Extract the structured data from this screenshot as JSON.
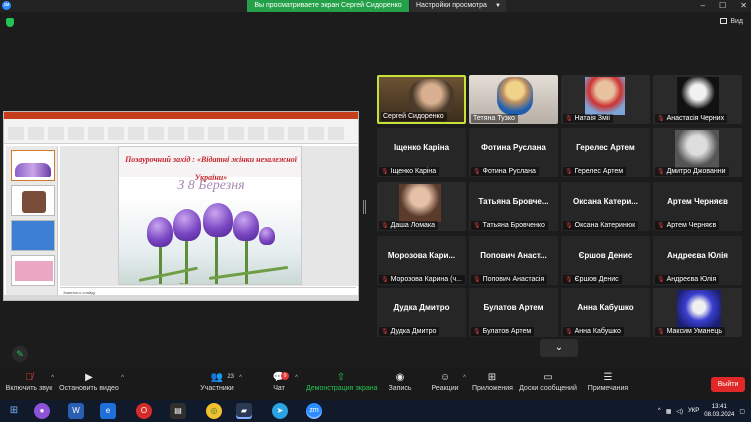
{
  "app": {
    "app_icon_text": "зм",
    "sharing_banner": "Вы просматриваете экран Сергей Сидоренко",
    "view_settings": "Настройки просмотра",
    "view_button": "Вид"
  },
  "slide": {
    "title": "Позаурочний захід : «Відатні жінки незалежної України»",
    "date_text": "З 8 Березня",
    "notes_placeholder": "Заметки к слайду"
  },
  "participants": [
    {
      "name": "Сергей Сидоренко",
      "big": "",
      "muted": false,
      "video": true
    },
    {
      "name": "Тетяна Тузко",
      "big": "",
      "muted": false,
      "video": true
    },
    {
      "name": "Натаія Зміі",
      "big": "",
      "muted": true,
      "video": true
    },
    {
      "name": "Анастасія Черних",
      "big": "",
      "muted": true,
      "video": true
    },
    {
      "name": "Іщенко Каріна",
      "big": "Іщенко Каріна",
      "muted": true,
      "video": false
    },
    {
      "name": "Фотина Руслана",
      "big": "Фотина Руслана",
      "muted": true,
      "video": false
    },
    {
      "name": "Герелес Артем",
      "big": "Герелес Артем",
      "muted": true,
      "video": false
    },
    {
      "name": "Дмитро Джованни",
      "big": "",
      "muted": true,
      "video": true
    },
    {
      "name": "Даша Ломака",
      "big": "",
      "muted": true,
      "video": true
    },
    {
      "name": "Татьяна Бровченко",
      "big": "Татьяна Бровче...",
      "muted": true,
      "video": false
    },
    {
      "name": "Оксана Катеринюк",
      "big": "Оксана Катери...",
      "muted": true,
      "video": false
    },
    {
      "name": "Артем Черняєв",
      "big": "Артем Черняєв",
      "muted": true,
      "video": false
    },
    {
      "name": "Морозова Карина (ч...",
      "big": "Морозова Кари...",
      "muted": true,
      "video": false
    },
    {
      "name": "Попович Анастасія",
      "big": "Попович Анаст...",
      "muted": true,
      "video": false
    },
    {
      "name": "Єршов Денис",
      "big": "Єршов Денис",
      "muted": true,
      "video": false
    },
    {
      "name": "Андреєва Юлія",
      "big": "Андреєва Юлія",
      "muted": true,
      "video": false
    },
    {
      "name": "Дудка Дмитро",
      "big": "Дудка Дмитро",
      "muted": true,
      "video": false
    },
    {
      "name": "Булатов Артем",
      "big": "Булатов Артем",
      "muted": true,
      "video": false
    },
    {
      "name": "Анна Кабушко",
      "big": "Анна Кабушко",
      "muted": true,
      "video": false
    },
    {
      "name": "Максим Уманець",
      "big": "",
      "muted": true,
      "video": true
    }
  ],
  "toolbar": {
    "mute": "Включить звук",
    "video": "Остановить видео",
    "participants": "Участники",
    "participants_count": "23",
    "chat": "Чат",
    "chat_badge": "9",
    "share": "Демонстрация экрана",
    "record": "Запись",
    "reactions": "Реакции",
    "apps": "Приложения",
    "whiteboards": "Доски сообщений",
    "notes": "Примечания",
    "end": "Выйти"
  },
  "taskbar": {
    "lang": "УКР",
    "time": "13:41",
    "date": "08.03.2024"
  },
  "colors": {
    "accent_green": "#23c552",
    "end_red": "#e02828",
    "active_speaker": "#c7e13a",
    "zoom_blue": "#2d8cff"
  }
}
